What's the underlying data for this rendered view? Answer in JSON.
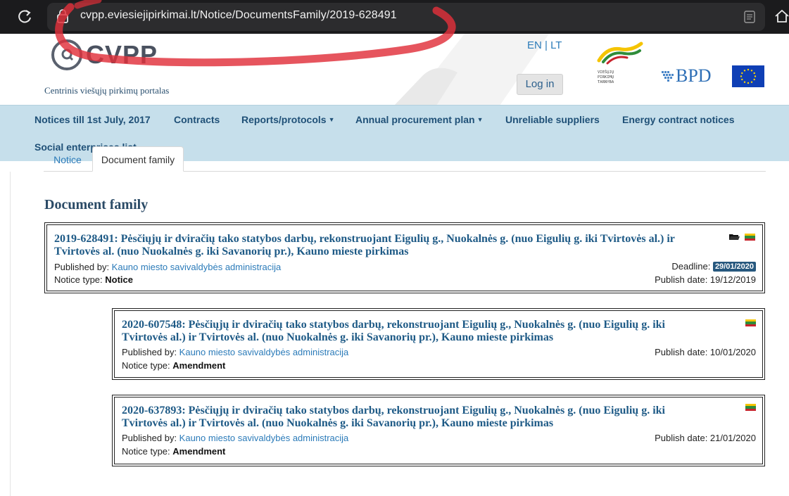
{
  "browser": {
    "url": "cvpp.eviesiejipirkimai.lt/Notice/DocumentsFamily/2019-628491"
  },
  "header": {
    "logo_text": "CVPP",
    "subtitle": "Centrinis viešųjų pirkimų portalas",
    "lang_en": "EN",
    "lang_separator": " | ",
    "lang_lt": "LT",
    "login_label": "Log in",
    "vpt_logo_text": [
      "VIEŠŲJŲ",
      "PIRKIMŲ",
      "TARNYBA"
    ],
    "bpd_logo_text": "BPD"
  },
  "nav": {
    "items": [
      {
        "label": "Notices till 1st July, 2017"
      },
      {
        "label": "Contracts"
      },
      {
        "label": "Reports/protocols",
        "dropdown": true
      },
      {
        "label": "Annual procurement plan",
        "dropdown": true
      },
      {
        "label": "Unreliable suppliers"
      },
      {
        "label": "Energy contract notices"
      },
      {
        "label": "Social enterprises list"
      }
    ],
    "caret": "▼"
  },
  "tabs": {
    "notice": "Notice",
    "document_family": "Document family"
  },
  "page": {
    "heading": "Document family"
  },
  "labels": {
    "published_by": "Published by: ",
    "notice_type": "Notice type: ",
    "deadline": "Deadline: ",
    "publish_date": "Publish date: "
  },
  "documents": [
    {
      "title_line1": "2019-628491: Pėsčiųjų ir dviračių tako statybos darbų, rekonstruojant Eigulių g., Nuokalnės g. (nuo Eigulių g. iki Tvirtovės al.) ir",
      "title_line2": "Tvirtovės al. (nuo Nuokalnės g. iki Savanorių pr.), Kauno mieste pirkimas",
      "publisher": "Kauno miesto savivaldybės administracija",
      "notice_type": "Notice",
      "deadline": "29/01/2020",
      "publish_date": "19/12/2019"
    },
    {
      "title_line1": "2020-607548: Pėsčiųjų ir dviračių tako statybos darbų, rekonstruojant Eigulių g., Nuokalnės g. (nuo Eigulių g. iki",
      "title_line2": "Tvirtovės al.) ir Tvirtovės al. (nuo Nuokalnės g. iki Savanorių pr.), Kauno mieste pirkimas",
      "publisher": "Kauno miesto savivaldybės administracija",
      "notice_type": "Amendment",
      "publish_date": "10/01/2020"
    },
    {
      "title_line1": "2020-637893: Pėsčiųjų ir dviračių tako statybos darbų, rekonstruojant Eigulių g., Nuokalnės g. (nuo Eigulių g. iki",
      "title_line2": "Tvirtovės al.) ir Tvirtovės al. (nuo Nuokalnės g. iki Savanorių pr.), Kauno mieste pirkimas",
      "publisher": "Kauno miesto savivaldybės administracija",
      "notice_type": "Amendment",
      "publish_date": "21/01/2020"
    }
  ],
  "colors": {
    "nav_bg": "#c6dfeb",
    "link": "#2b7bb9",
    "title": "#1e5a86",
    "badge": "#27587e",
    "scribble": "#e0303a",
    "flag_yellow": "#f5c400",
    "flag_green": "#2f8c3a",
    "flag_red": "#c8232c"
  },
  "icons": {
    "reload": "reload-icon",
    "lock": "lock-icon",
    "reader": "reader-icon",
    "home": "home-icon",
    "folder": "folder-icon",
    "flag": "lithuania-flag-icon"
  }
}
